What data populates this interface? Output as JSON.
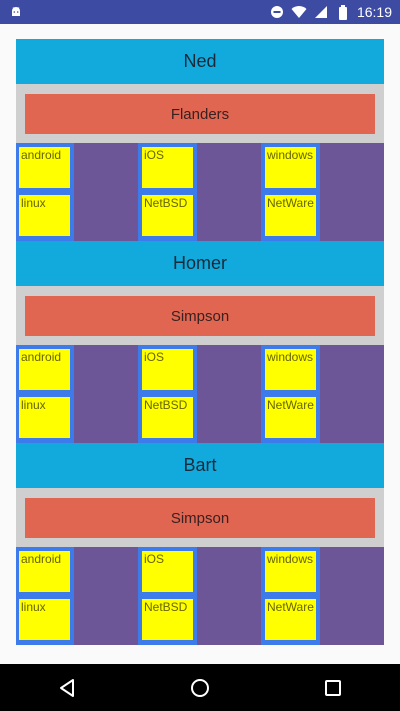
{
  "status_bar": {
    "time": "16:19",
    "icons": [
      "android-icon",
      "do-not-disturb-icon",
      "wifi-icon",
      "signal-icon",
      "battery-icon"
    ]
  },
  "people": [
    {
      "first_name": "Ned",
      "last_name": "Flanders",
      "os_row_1": [
        "android",
        "iOS",
        "windows"
      ],
      "os_row_2": [
        "linux",
        "NetBSD",
        "NetWare"
      ]
    },
    {
      "first_name": "Homer",
      "last_name": "Simpson",
      "os_row_1": [
        "android",
        "iOS",
        "windows"
      ],
      "os_row_2": [
        "linux",
        "NetBSD",
        "NetWare"
      ]
    },
    {
      "first_name": "Bart",
      "last_name": "Simpson",
      "os_row_1": [
        "android",
        "iOS",
        "windows"
      ],
      "os_row_2": [
        "linux",
        "NetBSD",
        "NetWare"
      ]
    }
  ],
  "nav_bar": {
    "buttons": [
      "back-icon",
      "home-icon",
      "recents-icon"
    ]
  },
  "colors": {
    "status_bar": "#3d4ba3",
    "title_bar": "#12aadc",
    "sub_wrap": "#cfcfcf",
    "sub_bar": "#e06651",
    "grid_bg": "#3d7bea",
    "grid_purple": "#6c5697",
    "cell": "#ffff00"
  }
}
